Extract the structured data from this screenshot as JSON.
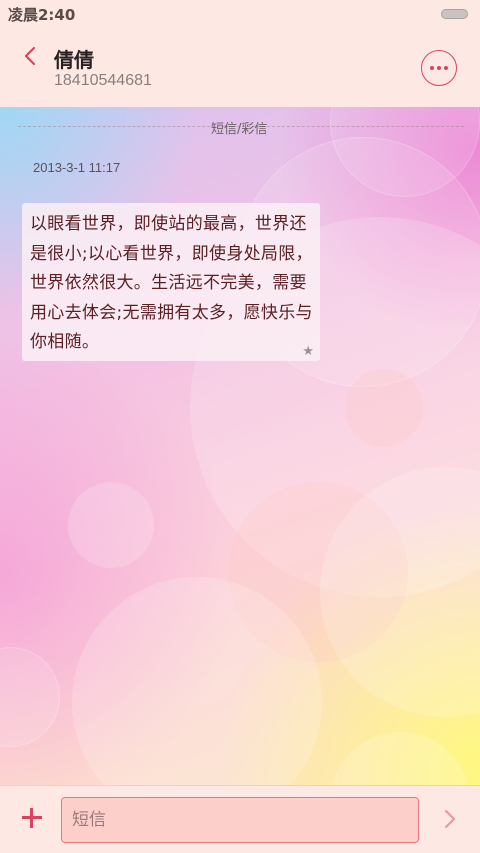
{
  "status_bar": {
    "time": "凌晨2:40"
  },
  "header": {
    "contact_name": "倩倩",
    "contact_number": "18410544681"
  },
  "conversation": {
    "channel_label": "短信/彩信",
    "messages": [
      {
        "timestamp": "2013-3-1 11:17",
        "text": "以眼看世界，即使站的最高，世界还是很小;以心看世界，即使身处局限，世界依然很大。生活远不完美，需要用心去体会;无需拥有太多，愿快乐与你相随。",
        "starred": true
      }
    ]
  },
  "input_bar": {
    "placeholder": "短信",
    "value": ""
  },
  "colors": {
    "accent": "#d9445c",
    "header_bg": "#fde8e4",
    "message_text": "#5a1f24"
  },
  "icons": [
    "back-icon",
    "more-icon",
    "star-icon",
    "add-icon",
    "send-icon"
  ]
}
